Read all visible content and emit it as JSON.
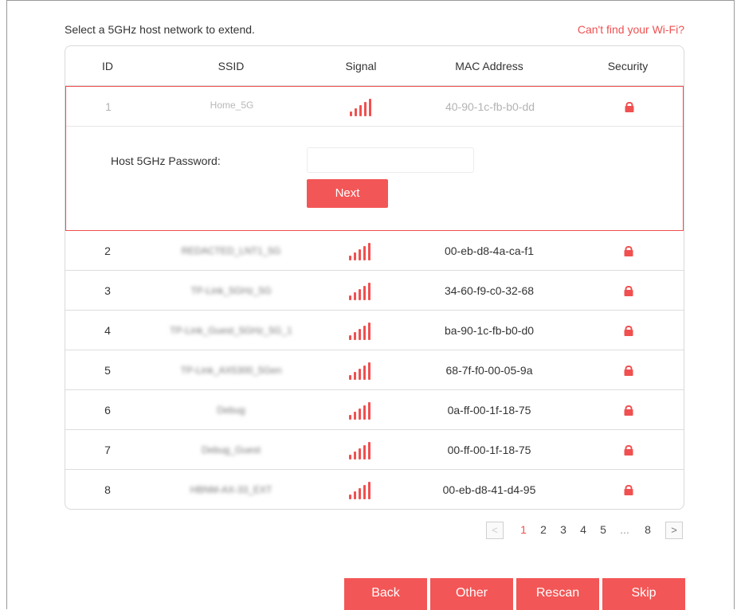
{
  "header": {
    "instruction": "Select a 5GHz host network to extend.",
    "cant_find_link": "Can't find your Wi-Fi?"
  },
  "table": {
    "columns": [
      "ID",
      "SSID",
      "Signal",
      "MAC Address",
      "Security"
    ],
    "rows": [
      {
        "id": "1",
        "ssid": "Home_5G",
        "mac": "40-90-1c-fb-b0-dd",
        "signal_bars": 5,
        "secured": true,
        "selected": true
      },
      {
        "id": "2",
        "ssid": "REDACTED_LNT1_5G",
        "mac": "00-eb-d8-4a-ca-f1",
        "signal_bars": 5,
        "secured": true
      },
      {
        "id": "3",
        "ssid": "TP-Link_5GHz_5G",
        "mac": "34-60-f9-c0-32-68",
        "signal_bars": 5,
        "secured": true
      },
      {
        "id": "4",
        "ssid": "TP-Link_Guest_5GHz_5G_1",
        "mac": "ba-90-1c-fb-b0-d0",
        "signal_bars": 5,
        "secured": true
      },
      {
        "id": "5",
        "ssid": "TP-Link_AX5300_5Gen",
        "mac": "68-7f-f0-00-05-9a",
        "signal_bars": 5,
        "secured": true
      },
      {
        "id": "6",
        "ssid": "Debug",
        "mac": "0a-ff-00-1f-18-75",
        "signal_bars": 5,
        "secured": true
      },
      {
        "id": "7",
        "ssid": "Debug_Guest",
        "mac": "00-ff-00-1f-18-75",
        "signal_bars": 5,
        "secured": true
      },
      {
        "id": "8",
        "ssid": "HBNM-AX-33_EXT",
        "mac": "00-eb-d8-41-d4-95",
        "signal_bars": 5,
        "secured": true
      }
    ]
  },
  "expanded": {
    "password_label": "Host 5GHz Password:",
    "password_value": "",
    "next_label": "Next"
  },
  "pagination": {
    "prev": "<",
    "pages": [
      "1",
      "2",
      "3",
      "4",
      "5"
    ],
    "ellipsis": "...",
    "last": "8",
    "next": ">",
    "current": "1"
  },
  "buttons": {
    "back": "Back",
    "other": "Other",
    "rescan": "Rescan",
    "skip": "Skip"
  },
  "colors": {
    "accent": "#f35656",
    "border": "#dddddd"
  },
  "icons": {
    "signal": "signal-strength-icon",
    "security": "lock-icon"
  }
}
